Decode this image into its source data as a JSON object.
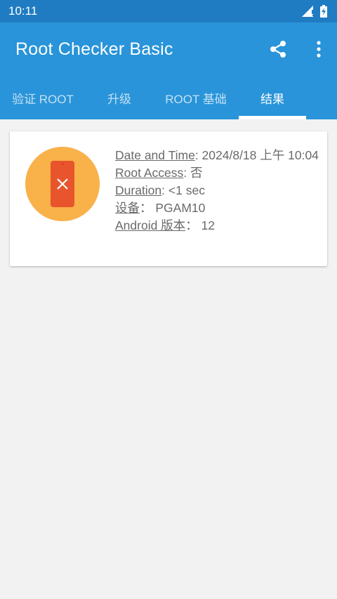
{
  "status_bar": {
    "time": "10:11"
  },
  "app_bar": {
    "title": "Root Checker Basic",
    "share_icon": "share-icon",
    "more_icon": "more-vert-icon"
  },
  "tabs": [
    {
      "label": "验证 ROOT",
      "active": false
    },
    {
      "label": "升级",
      "active": false
    },
    {
      "label": "ROOT 基础",
      "active": false
    },
    {
      "label": "结果",
      "active": true
    }
  ],
  "result": {
    "icon": "phone-fail-icon",
    "rows": [
      {
        "label": "Date and Time",
        "sep": ": ",
        "value": "2024/8/18 上午 10:04"
      },
      {
        "label": "Root Access",
        "sep": ": ",
        "value": "否"
      },
      {
        "label": "Duration",
        "sep": ": ",
        "value": "<1 sec"
      },
      {
        "label": "设备",
        "sep": "：  ",
        "value": "PGAM10"
      },
      {
        "label": "Android 版本",
        "sep": "：  ",
        "value": "12"
      }
    ]
  },
  "colors": {
    "status_bar": "#1f7cc2",
    "app_bar": "#2994d9",
    "circle": "#f9b14a",
    "phone": "#e8542b"
  }
}
